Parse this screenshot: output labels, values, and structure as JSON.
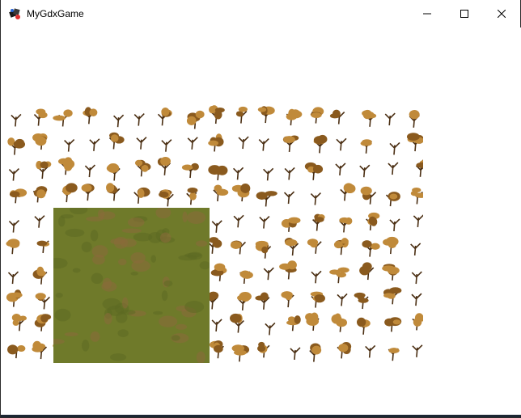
{
  "window": {
    "title": "MyGdxGame",
    "app_icon": "libgdx-app-icon"
  },
  "controls": {
    "minimize_icon": "minimize-icon",
    "maximize_icon": "maximize-icon",
    "close_icon": "close-icon"
  },
  "scene": {
    "background_color": "#ffffff",
    "tile_layer": "autumn-tree-sprites",
    "ground_tile": "grass-dirt-texture",
    "tree_colors": [
      "#c08a3a",
      "#8a5a1e",
      "#4a2e12"
    ],
    "grass_colors": [
      "#6f7a2a",
      "#8b6a3a"
    ]
  }
}
